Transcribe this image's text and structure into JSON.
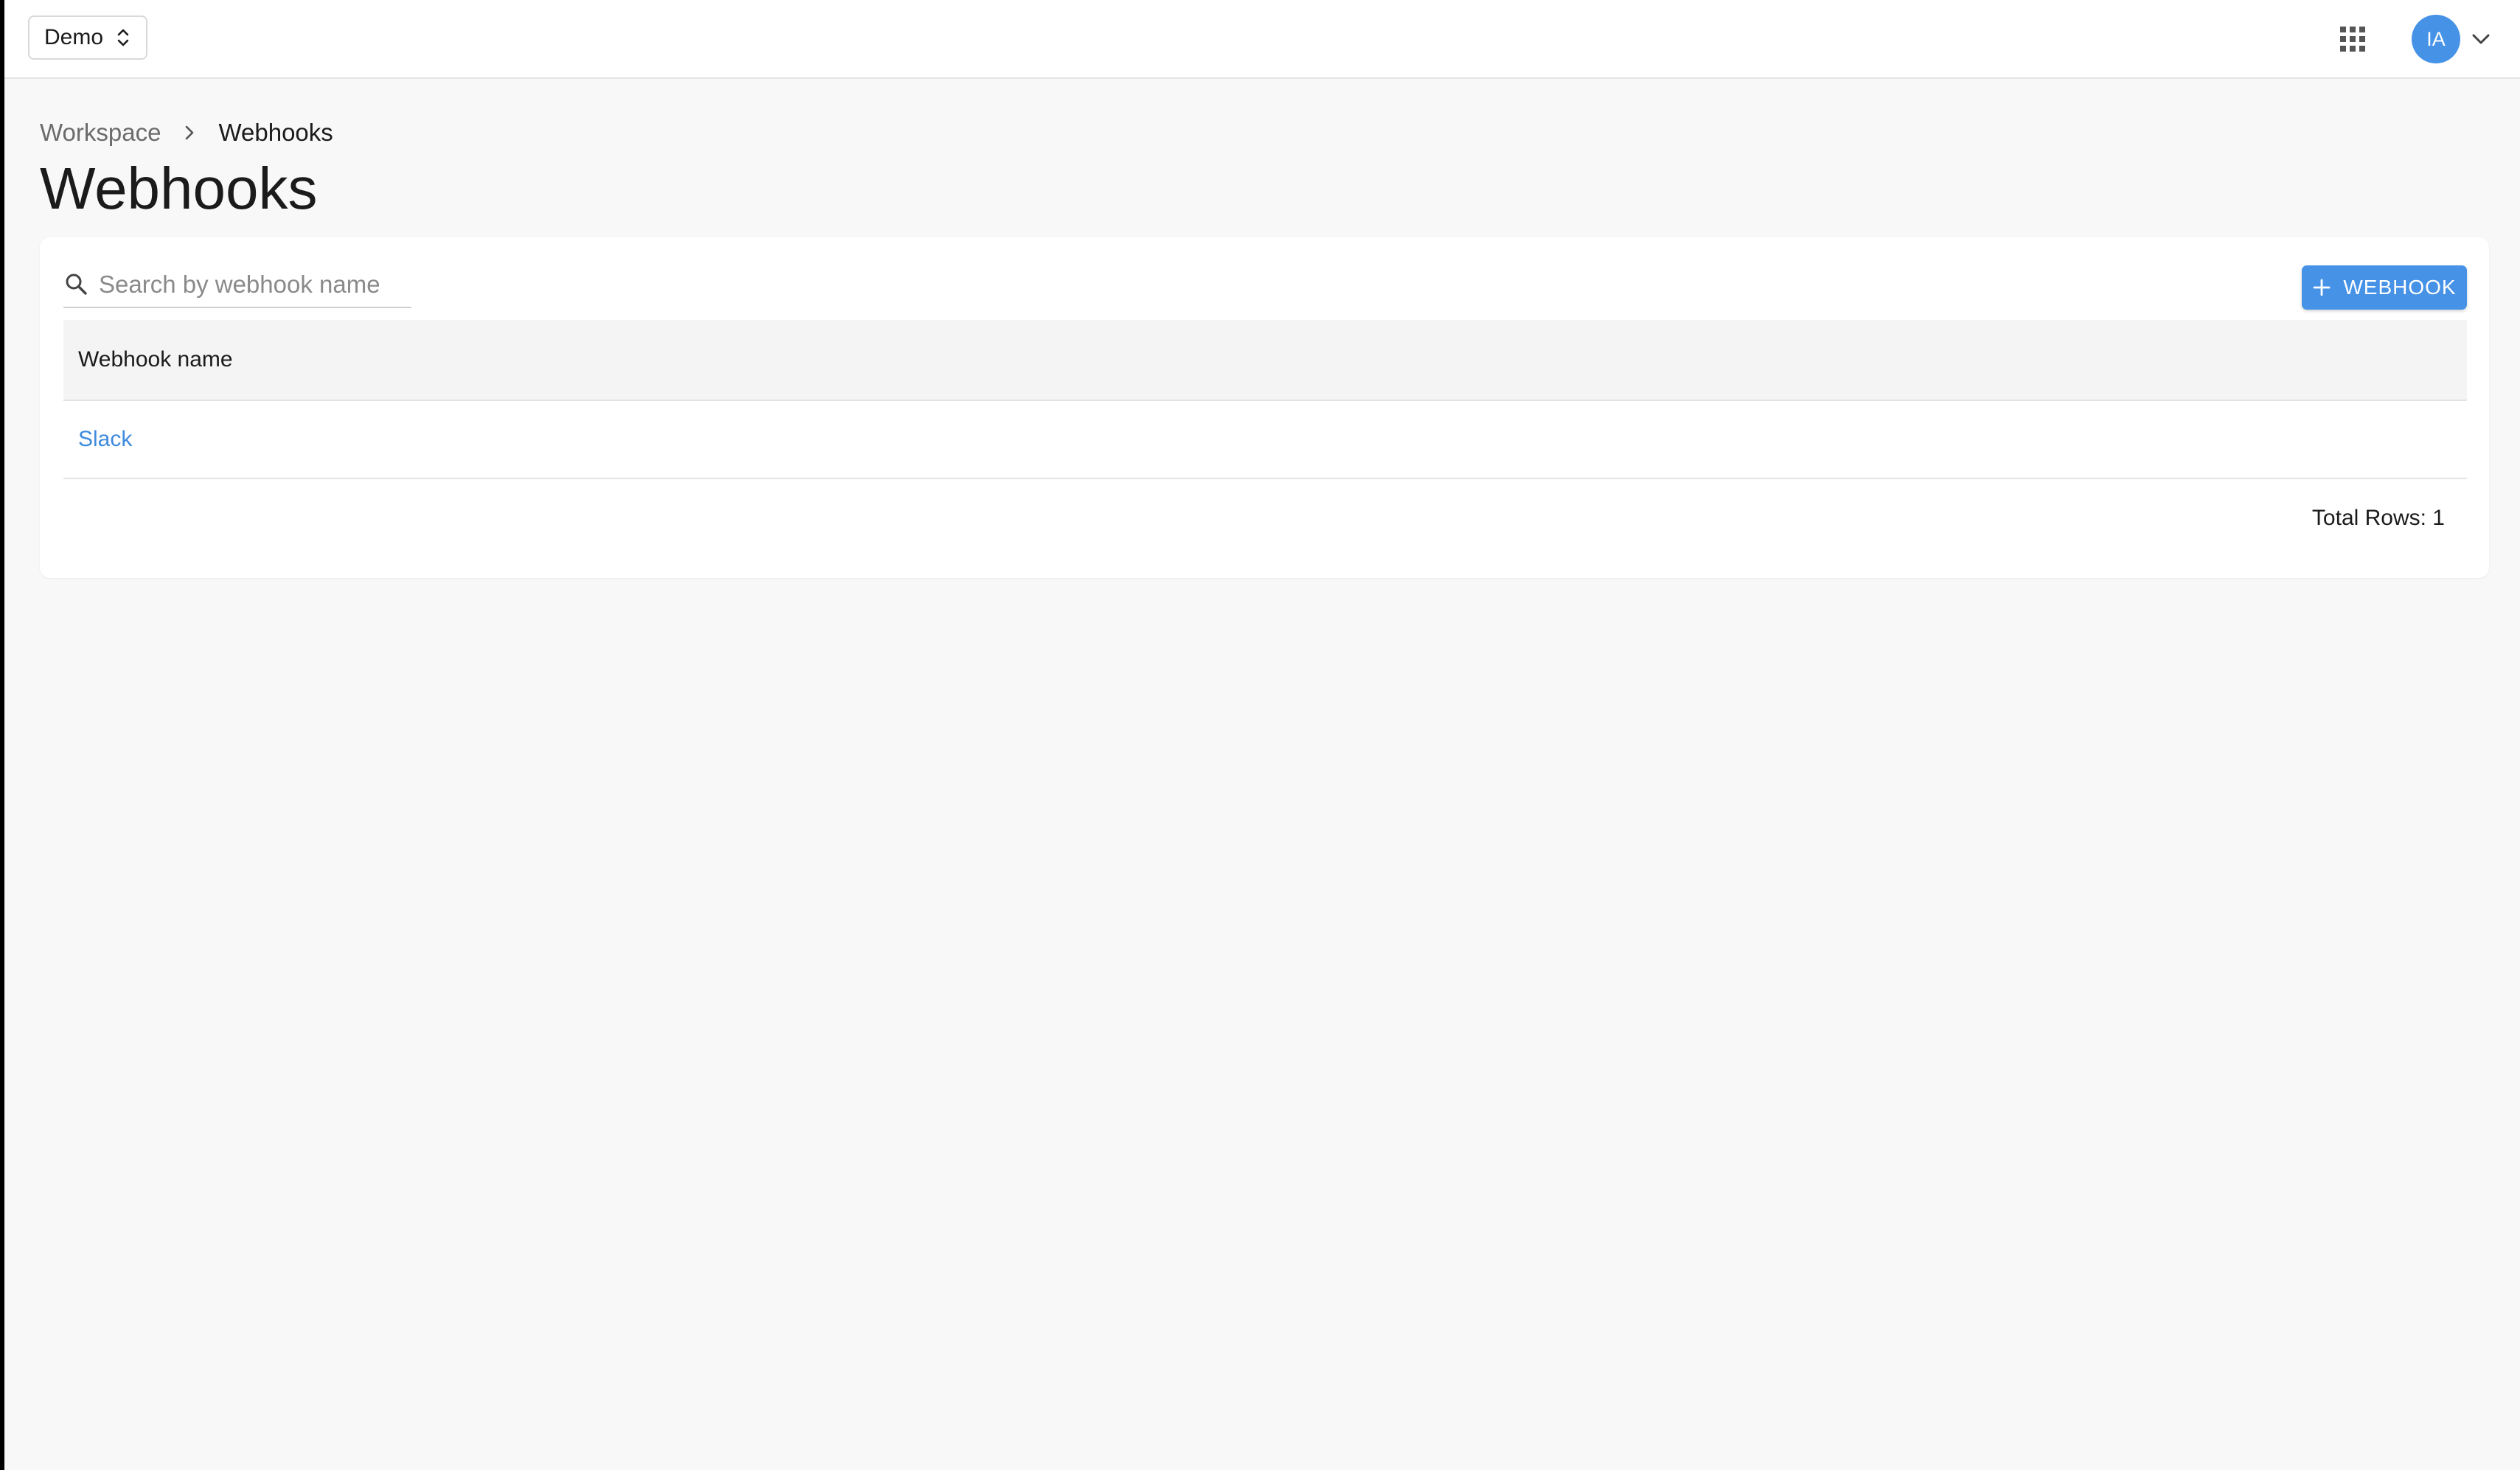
{
  "topbar": {
    "workspace_selector": {
      "label": "Demo",
      "icon": "unfold-more-icon"
    },
    "apps_icon": "apps-grid-icon",
    "user": {
      "initials": "IA",
      "avatar_color": "#4592e6",
      "menu_icon": "chevron-down-icon"
    }
  },
  "breadcrumb": {
    "items": [
      {
        "label": "Workspace"
      },
      {
        "label": "Webhooks"
      }
    ],
    "separator_icon": "chevron-right-icon"
  },
  "page": {
    "title": "Webhooks"
  },
  "toolbar": {
    "search": {
      "placeholder": "Search by webhook name",
      "value": "",
      "icon": "search-icon"
    },
    "add_button": {
      "label": "WEBHOOK",
      "icon": "plus-icon"
    }
  },
  "table": {
    "columns": [
      {
        "label": "Webhook name"
      }
    ],
    "rows": [
      {
        "name": "Slack"
      }
    ],
    "footer": {
      "total_rows_label": "Total Rows: 1"
    }
  },
  "colors": {
    "accent": "#4592e6",
    "link": "#3f8bde",
    "background": "#f8f8f8",
    "surface": "#ffffff"
  }
}
